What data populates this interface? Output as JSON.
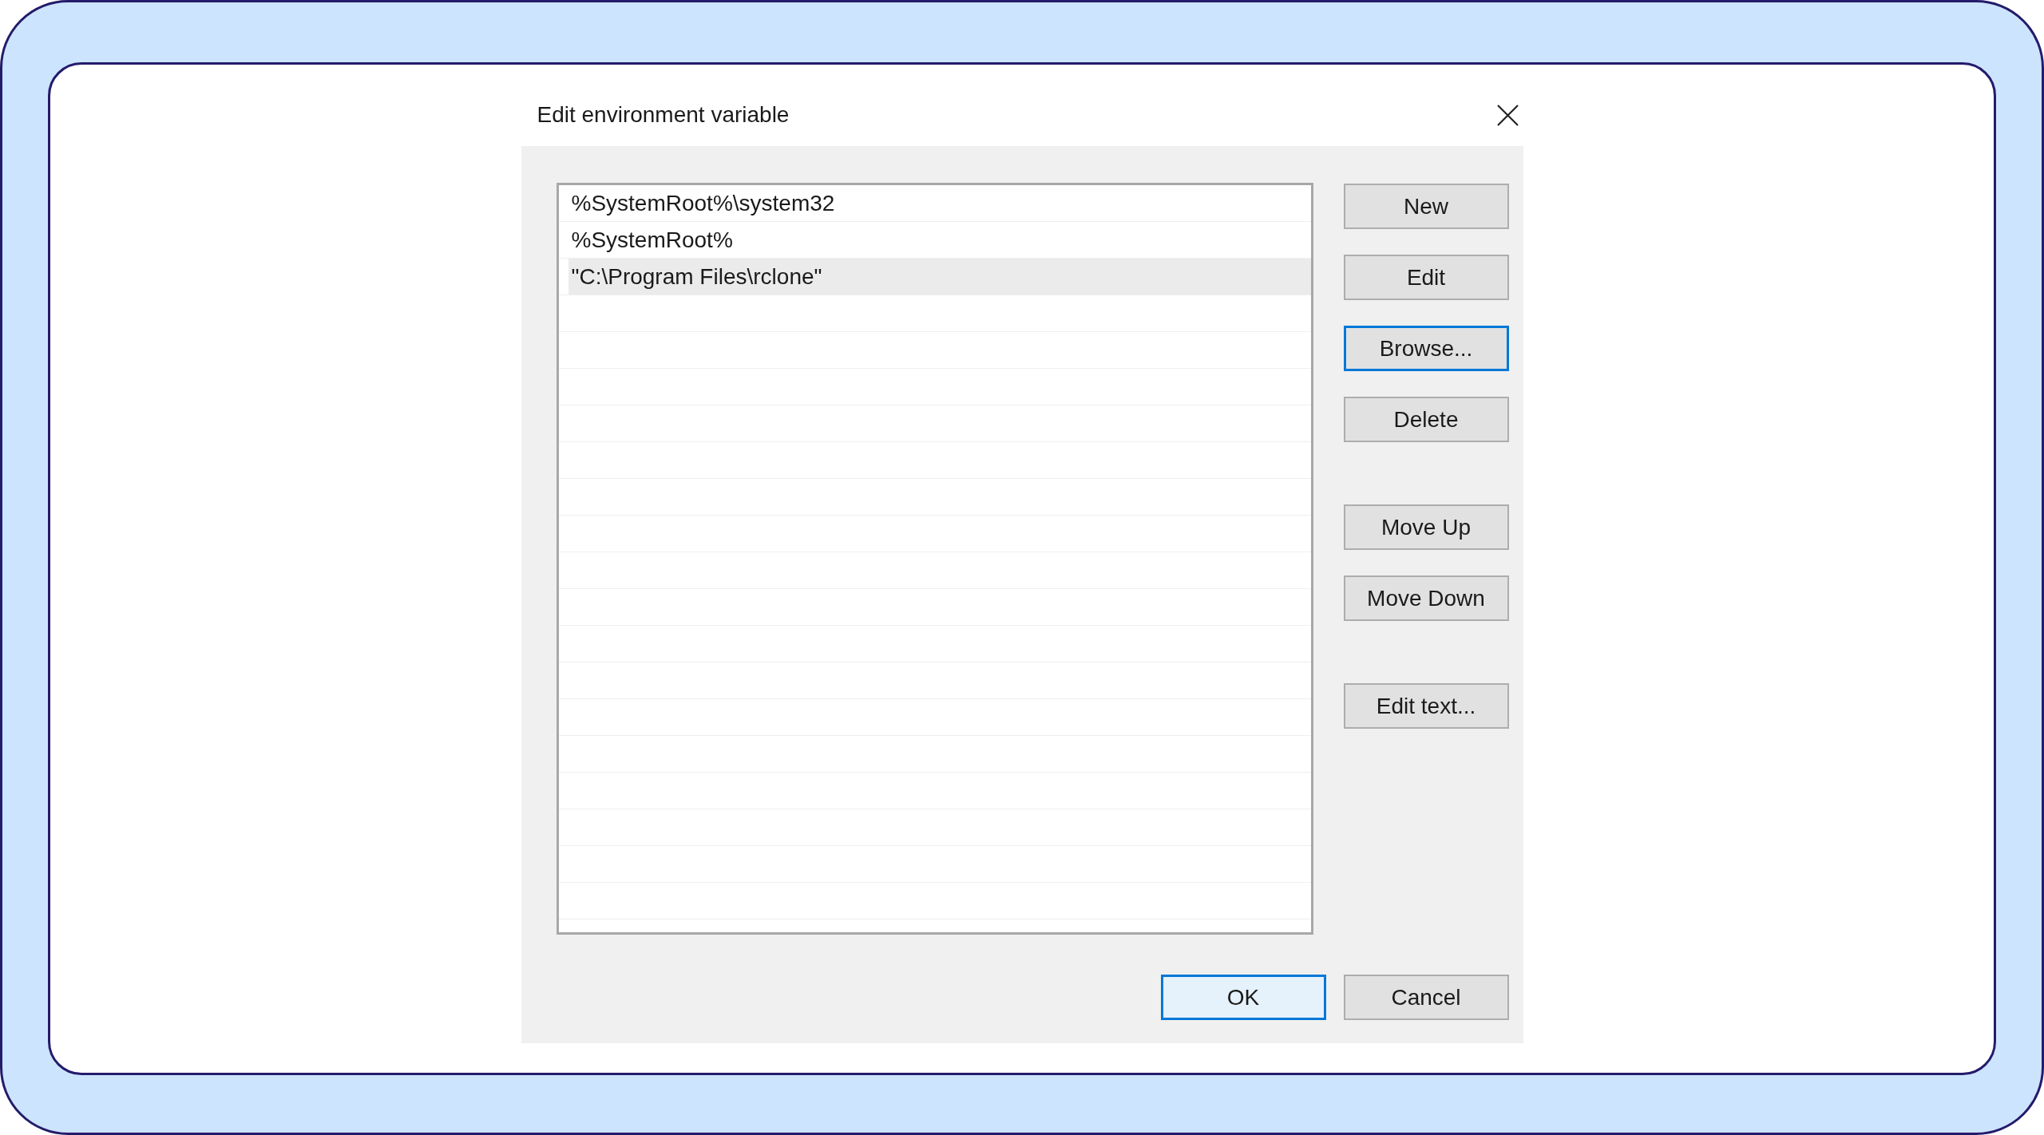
{
  "dialog": {
    "title": "Edit environment variable"
  },
  "path_list": {
    "items": [
      {
        "text": "%SystemRoot%\\system32",
        "selected": false
      },
      {
        "text": "%SystemRoot%",
        "selected": false
      },
      {
        "text": "\"C:\\Program Files\\rclone\"",
        "selected": true
      }
    ]
  },
  "button_groups": [
    [
      {
        "label": "New",
        "focused": false
      },
      {
        "label": "Edit",
        "focused": false
      },
      {
        "label": "Browse...",
        "focused": true
      },
      {
        "label": "Delete",
        "focused": false
      }
    ],
    [
      {
        "label": "Move Up",
        "focused": false
      },
      {
        "label": "Move Down",
        "focused": false
      }
    ],
    [
      {
        "label": "Edit text...",
        "focused": false
      }
    ]
  ],
  "footer_buttons": [
    {
      "label": "OK",
      "default": true
    },
    {
      "label": "Cancel",
      "default": false
    }
  ]
}
